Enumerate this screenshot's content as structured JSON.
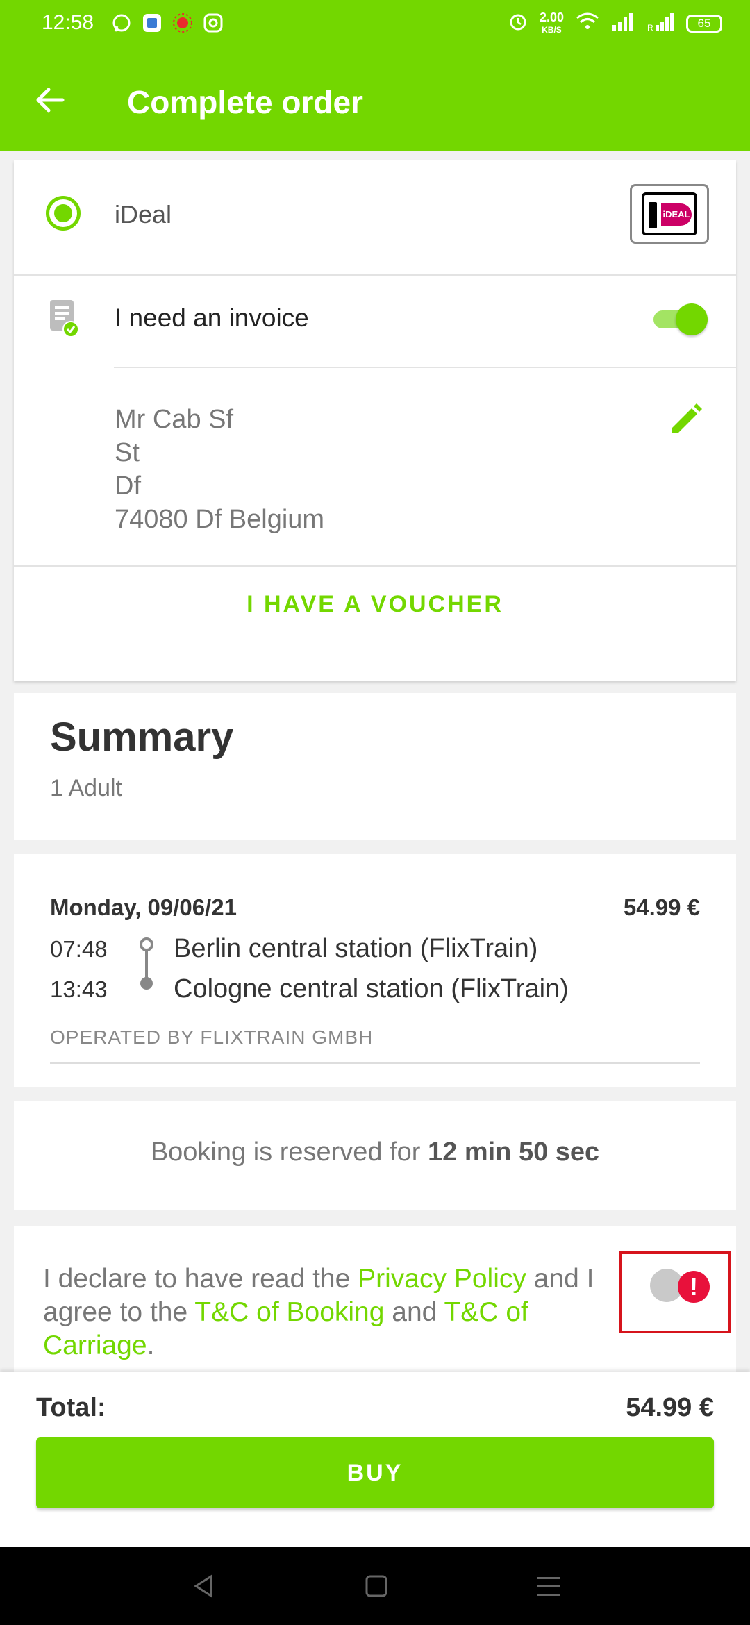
{
  "status_bar": {
    "time": "12:58",
    "net_speed": "2.00",
    "net_unit": "KB/S",
    "battery": "65"
  },
  "header": {
    "title": "Complete order"
  },
  "payment": {
    "method_label": "iDeal",
    "logo_text": "iDEAL"
  },
  "invoice": {
    "label": "I need an invoice",
    "enabled": true,
    "address_lines": [
      "Mr Cab Sf",
      "St",
      "Df",
      "74080 Df Belgium"
    ]
  },
  "voucher": {
    "label": "I HAVE A VOUCHER"
  },
  "summary": {
    "title": "Summary",
    "passengers": "1 Adult"
  },
  "trip": {
    "date": "Monday, 09/06/21",
    "price": "54.99 €",
    "stops": [
      {
        "time": "07:48",
        "name": "Berlin central station (FlixTrain)"
      },
      {
        "time": "13:43",
        "name": "Cologne central station (FlixTrain)"
      }
    ],
    "operator": "OPERATED BY FLIXTRAIN GMBH"
  },
  "reservation": {
    "prefix": "Booking is reserved for ",
    "remaining": "12 min 50 sec"
  },
  "terms": {
    "text_1": "I declare to have read the ",
    "link_privacy": "Privacy Policy",
    "text_2": " and I agree to the ",
    "link_booking": "T&C of Booking",
    "text_3": " and ",
    "link_carriage": "T&C of Carriage",
    "text_4": ".",
    "accepted": false
  },
  "footer": {
    "total_label": "Total:",
    "total_value": "54.99 €",
    "buy_label": "BUY"
  },
  "colors": {
    "brand_green": "#73d700",
    "alert_red": "#e8113b",
    "highlight_red": "#d6141c"
  },
  "icons": [
    "back-arrow-icon",
    "invoice-icon",
    "edit-icon",
    "alert-icon",
    "nav-back-icon",
    "nav-home-icon",
    "nav-menu-icon"
  ]
}
